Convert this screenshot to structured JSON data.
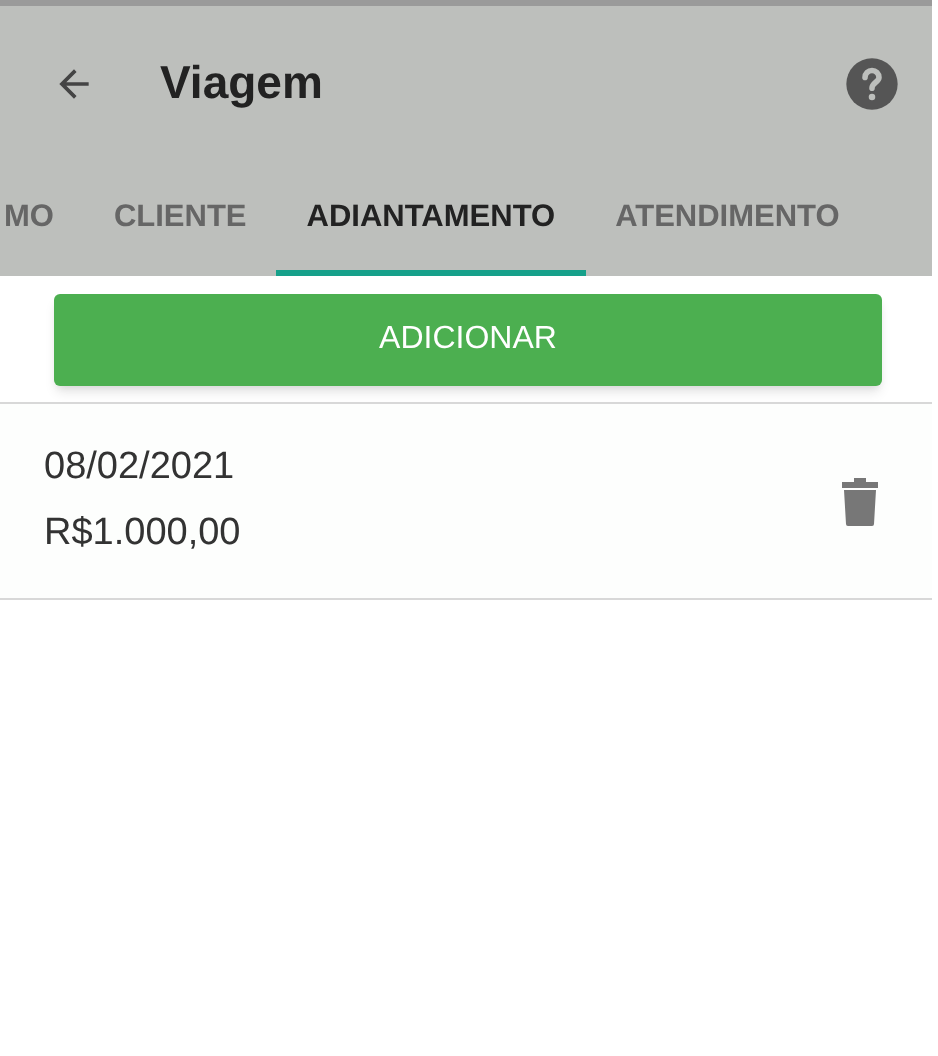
{
  "toolbar": {
    "title": "Viagem"
  },
  "tabs": [
    {
      "label": "MO",
      "selected": false
    },
    {
      "label": "CLIENTE",
      "selected": false
    },
    {
      "label": "ADIANTAMENTO",
      "selected": true
    },
    {
      "label": "ATENDIMENTO",
      "selected": false
    }
  ],
  "add_button": {
    "label": "ADICIONAR"
  },
  "advances": [
    {
      "date": "08/02/2021",
      "amount": "R$1.000,00"
    }
  ]
}
